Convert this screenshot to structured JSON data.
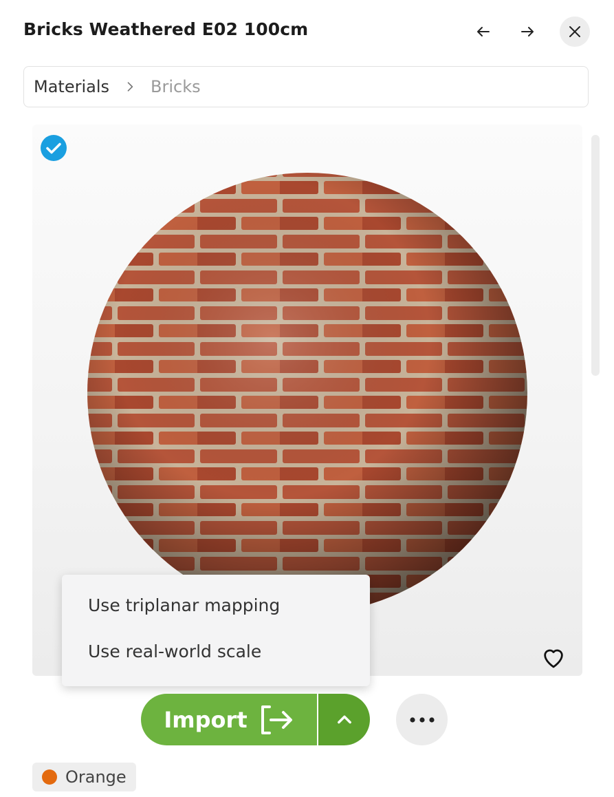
{
  "header": {
    "title": "Bricks Weathered E02 100cm"
  },
  "breadcrumb": {
    "root": "Materials",
    "current": "Bricks"
  },
  "popup": {
    "items": [
      {
        "label": "Use triplanar mapping"
      },
      {
        "label": "Use real-world scale"
      }
    ]
  },
  "actions": {
    "import_label": "Import"
  },
  "tag": {
    "label": "Orange",
    "color": "#e36a0f"
  },
  "colors": {
    "accent": "#6db33f",
    "accent_dark": "#5ba12c",
    "check": "#1a9fe0"
  }
}
